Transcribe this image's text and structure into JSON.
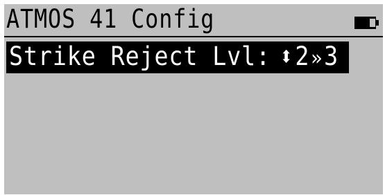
{
  "header": {
    "title": "ATMOS 41 Config",
    "battery_icon": "battery-icon"
  },
  "menu": {
    "items": [
      {
        "label": "Strike Reject Lvl:",
        "adjust_icon": "up-down-arrows-icon",
        "adjust_glyph": "⬍",
        "current_value": "2",
        "change_icon": "double-chevron-right-icon",
        "change_glyph": "»",
        "new_value": "3",
        "selected": true
      }
    ]
  },
  "colors": {
    "screen_bg": "#bfbfbf",
    "foreground": "#000000",
    "highlight_text": "#ffffff"
  }
}
